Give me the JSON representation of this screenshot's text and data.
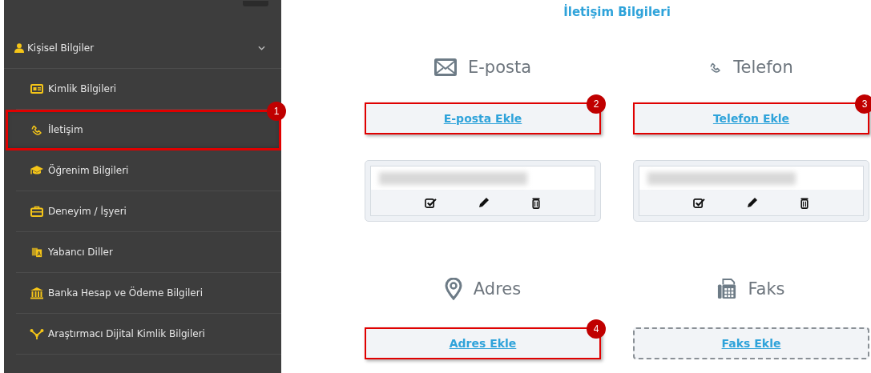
{
  "sidebar": {
    "section": {
      "label": "Kişisel Bilgiler",
      "expanded": true
    },
    "items": [
      {
        "label": "Kimlik Bilgileri",
        "selected": false
      },
      {
        "label": "İletişim",
        "selected": true,
        "badge": "1"
      },
      {
        "label": "Öğrenim Bilgileri",
        "selected": false
      },
      {
        "label": "Deneyim / İşyeri",
        "selected": false
      },
      {
        "label": "Yabancı Diller",
        "selected": false
      },
      {
        "label": "Banka Hesap ve Ödeme Bilgileri",
        "selected": false
      },
      {
        "label": "Araştırmacı Dijital Kimlik Bilgileri",
        "selected": false
      }
    ]
  },
  "page_title": "İletişim Bilgileri",
  "sections": [
    {
      "title": "E-posta",
      "add_button": {
        "label": "E-posta Ekle",
        "badge": "2",
        "highlighted": true
      },
      "has_entry": true
    },
    {
      "title": "Telefon",
      "add_button": {
        "label": "Telefon Ekle",
        "badge": "3",
        "highlighted": true
      },
      "has_entry": true
    },
    {
      "title": "Adres",
      "add_button": {
        "label": "Adres Ekle",
        "badge": "4",
        "highlighted": true
      },
      "has_entry": false
    },
    {
      "title": "Faks",
      "add_button": {
        "label": "Faks Ekle",
        "highlighted": false
      },
      "has_entry": false
    }
  ]
}
